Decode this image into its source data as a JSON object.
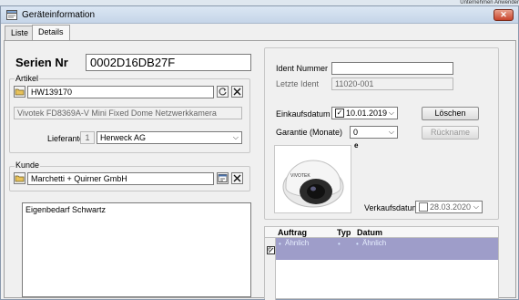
{
  "background": {
    "top_right_text": "Unternehmen  Anwender"
  },
  "window": {
    "title": "Geräteinformation",
    "close_label": "✕"
  },
  "tabs": [
    {
      "label": "Liste"
    },
    {
      "label": "Details"
    }
  ],
  "serial": {
    "label": "Serien Nr",
    "value": "0002D16DB27F"
  },
  "artikel": {
    "group_label": "Artikel",
    "value": "HW139170",
    "description": "Vivotek FD8369A-V Mini Fixed Dome Netzwerkkamera",
    "lieferanten_label": "Lieferanten",
    "lieferanten_number": "1",
    "lieferanten_value": "Herweck AG"
  },
  "kunde": {
    "group_label": "Kunde",
    "value": "Marchetti + Quirner GmbH"
  },
  "notes": {
    "text": "Eigenbedarf Schwartz"
  },
  "ident": {
    "label": "Ident Nummer",
    "value": "",
    "letzte_label": "Letzte Ident",
    "letzte_value": "11020-001"
  },
  "einkauf": {
    "label": "Einkaufsdatum",
    "value": "10.01.2019",
    "checked": true
  },
  "garantie": {
    "label": "Garantie (Monate)",
    "value": "0"
  },
  "buttons": {
    "loeschen": "Löschen",
    "rueckname": "Rückname"
  },
  "verkauf": {
    "label": "Verkaufsdatum",
    "value": "28.03.2020",
    "checked": false
  },
  "image": {
    "caption": "e",
    "brand_text": "VIVOTEK"
  },
  "grid": {
    "columns": [
      "Auftrag",
      "Typ",
      "Datum"
    ],
    "rows": [
      {
        "auftrag": "Ähnlich",
        "typ": "",
        "datum": "Ähnlich"
      }
    ]
  },
  "colors": {
    "grid_row": "#9e9dc9",
    "titlebar": "#c5d5e8",
    "close": "#c7432b"
  },
  "icons": [
    "folder-icon",
    "refresh-icon",
    "delete-icon",
    "calendar-icon",
    "dropdown-icon",
    "filter-icon",
    "window-icon"
  ]
}
